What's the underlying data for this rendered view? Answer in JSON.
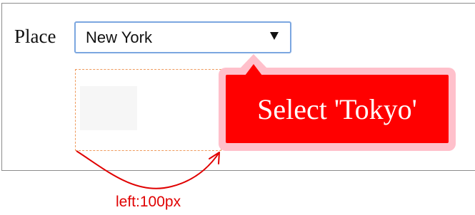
{
  "form": {
    "place_label": "Place",
    "place_select_value": "New York"
  },
  "tooltip": {
    "text": "Select 'Tokyo'"
  },
  "annotation": {
    "offset_label": "left:100px"
  },
  "colors": {
    "panel_border": "#8c8c8c",
    "select_border": "#7ba6e0",
    "dashed_outline": "#ef9a5c",
    "tooltip_fill": "#ff0000",
    "tooltip_halo": "#ffc0cb",
    "annotation": "#e00000"
  },
  "icons": {
    "select_caret": "chevron-down-icon",
    "annotation_arrow": "curved-arrow-icon"
  }
}
